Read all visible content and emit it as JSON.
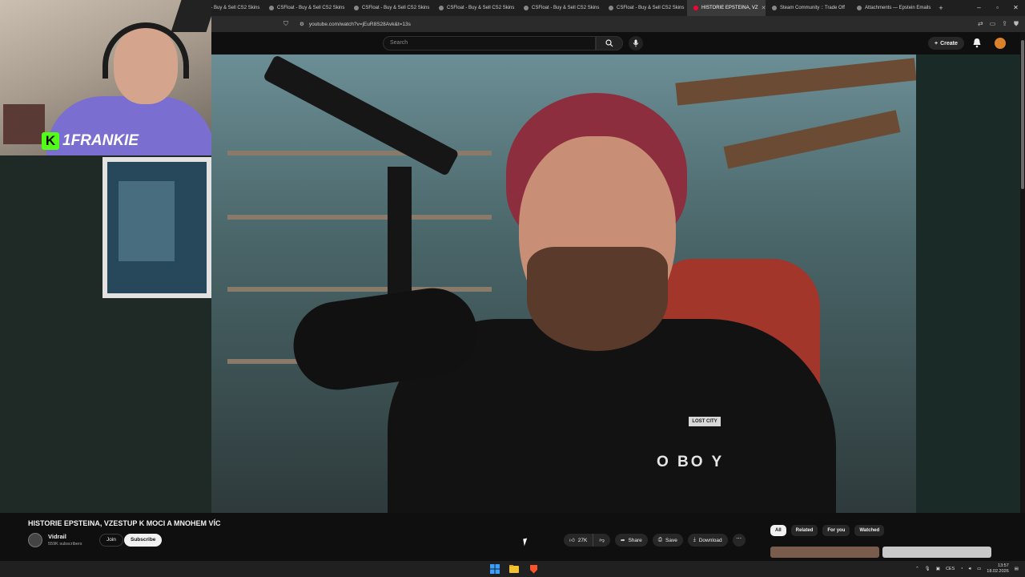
{
  "browser": {
    "tabs": [
      {
        "label": "CSFloat - Buy & Sell CS2 Skins"
      },
      {
        "label": "CSFloat - Buy & Sell CS2 Skins"
      },
      {
        "label": "CSFloat - Buy & Sell CS2 Skins"
      },
      {
        "label": "CSFloat - Buy & Sell CS2 Skins"
      },
      {
        "label": "CSFloat - Buy & Sell CS2 Skins"
      },
      {
        "label": "CSFloat - Buy & Sell CS2 Skins"
      },
      {
        "label": "HISTORIE EPSTEINA, VZ"
      },
      {
        "label": "Steam Community :: Trade Off"
      },
      {
        "label": "Attachments — Epstein Emails"
      }
    ],
    "url": "youtube.com/watch?v=jEuR8S28Avk&t=13s"
  },
  "youtube": {
    "search_placeholder": "Search",
    "create_label": "Create"
  },
  "stream_overlay": {
    "kick_logo": "K",
    "streamer_name": "1FRANKIE"
  },
  "video": {
    "title": "HISTORIE EPSTEINA, VZESTUP K MOCI A MNOHEM VÍC",
    "channel_name": "Vidrail",
    "subscribers": "559K subscribers",
    "join_label": "Join",
    "subscribe_label": "Subscribe",
    "like_count": "27K",
    "share_label": "Share",
    "save_label": "Save",
    "download_label": "Download",
    "jacket_label_text": "LOST CITY",
    "jacket_print_text": "O BO Y"
  },
  "recommendations": {
    "chips": [
      "All",
      "Related",
      "For you",
      "Watched"
    ]
  },
  "taskbar": {
    "language": "CES",
    "time": "13:57",
    "date": "18.02.2026"
  },
  "colors": {
    "youtube_red": "#ff0033",
    "kick_green": "#53fc18",
    "page_bg": "#0f0f0f"
  }
}
